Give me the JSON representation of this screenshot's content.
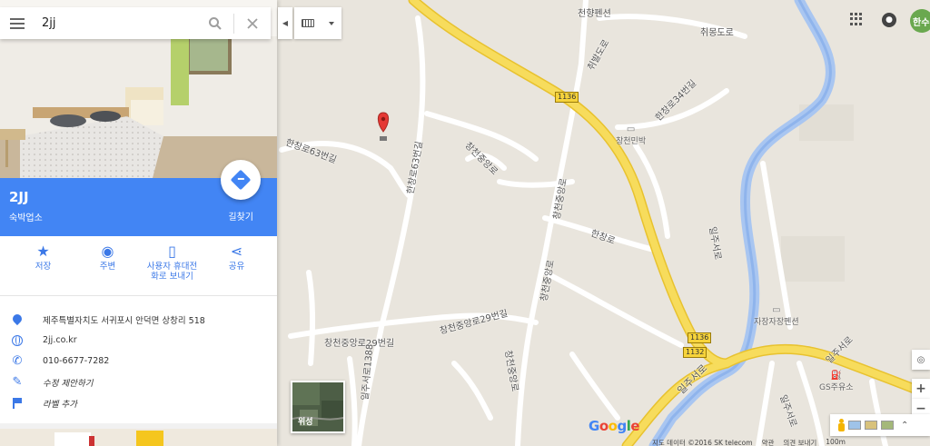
{
  "search": {
    "value": "2jj",
    "placeholder": ""
  },
  "place": {
    "name": "2JJ",
    "category": "숙박업소",
    "directions_label": "길찾기"
  },
  "actions": [
    {
      "label": "저장",
      "icon": "star-icon"
    },
    {
      "label": "주변",
      "icon": "nearby-pin-icon"
    },
    {
      "label": "사용자 휴대전\n화로 보내기",
      "icon": "send-to-phone-icon"
    },
    {
      "label": "공유",
      "icon": "share-icon"
    }
  ],
  "info": {
    "address": "제주특별자치도 서귀포시 안덕면 상창리 518",
    "website": "2jj.co.kr",
    "phone": "010-6677-7282",
    "suggest_edit": "수정 제안하기",
    "add_label": "라벨 추가"
  },
  "account": {
    "avatar_text": "한수"
  },
  "map": {
    "labels": {
      "chunhyang": "천향펜션",
      "chwibal": "취몽도로",
      "hanchang63": "한창로63번길",
      "hanchang2": "한창로63번길",
      "changcheon_jungang": "창천중앙로",
      "hanchang34": "한창로34번길",
      "changcheon_minbak": "창천민박",
      "hanchangro": "한창로",
      "changcheon_jungang_v": "창천중앙로",
      "ilju_seoro_v": "일주서로",
      "changcheon_29": "창천중앙로29번길",
      "changcheon_29b": "창천중앙로29번길",
      "changcheon_jungang_v2": "창천중앙로",
      "jajang": "자장자장펜션",
      "ilju_seoro": "일주서로",
      "ilju_seoro_2": "일주서로",
      "ilju_seoro_3": "일주서로",
      "gs": "GS주유소",
      "hanchang_bottom": "한창로",
      "ilju_1388": "일주서로1388",
      "chwibaldo": "취발도로"
    },
    "route_shields": [
      "1136",
      "1136",
      "1132"
    ],
    "satellite_label": "위성",
    "google": [
      "G",
      "o",
      "o",
      "g",
      "l",
      "e"
    ],
    "footer": [
      "지도 데이터 ©2016 SK telecom",
      "약관",
      "의견 보내기",
      "100m"
    ]
  }
}
